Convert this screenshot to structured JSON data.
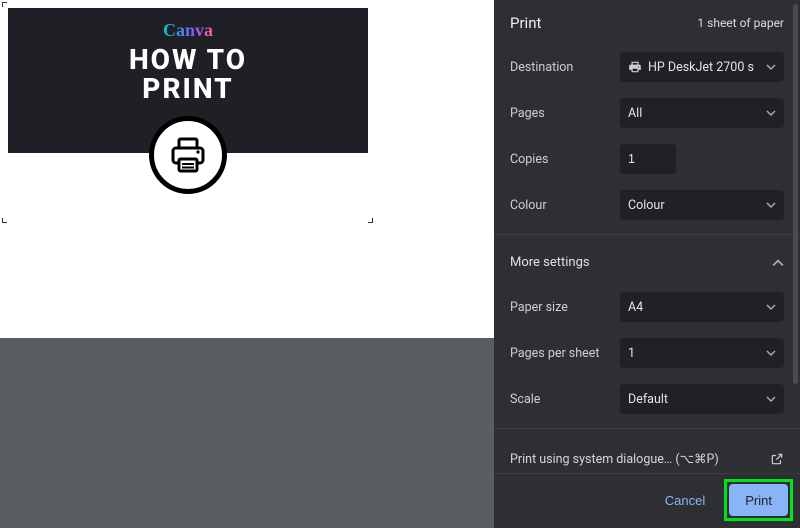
{
  "preview": {
    "logo_text": "Canva",
    "title_line1": "HOW TO",
    "title_line2": "PRINT"
  },
  "panel": {
    "title": "Print",
    "sheet_count": "1 sheet of paper",
    "destination_label": "Destination",
    "destination_value": "HP DeskJet 2700 s",
    "pages_label": "Pages",
    "pages_value": "All",
    "copies_label": "Copies",
    "copies_value": "1",
    "colour_label": "Colour",
    "colour_value": "Colour",
    "more_settings": "More settings",
    "paper_size_label": "Paper size",
    "paper_size_value": "A4",
    "pages_per_sheet_label": "Pages per sheet",
    "pages_per_sheet_value": "1",
    "scale_label": "Scale",
    "scale_value": "Default",
    "system_dialog": "Print using system dialogue… (⌥⌘P)",
    "cancel": "Cancel",
    "print": "Print"
  }
}
